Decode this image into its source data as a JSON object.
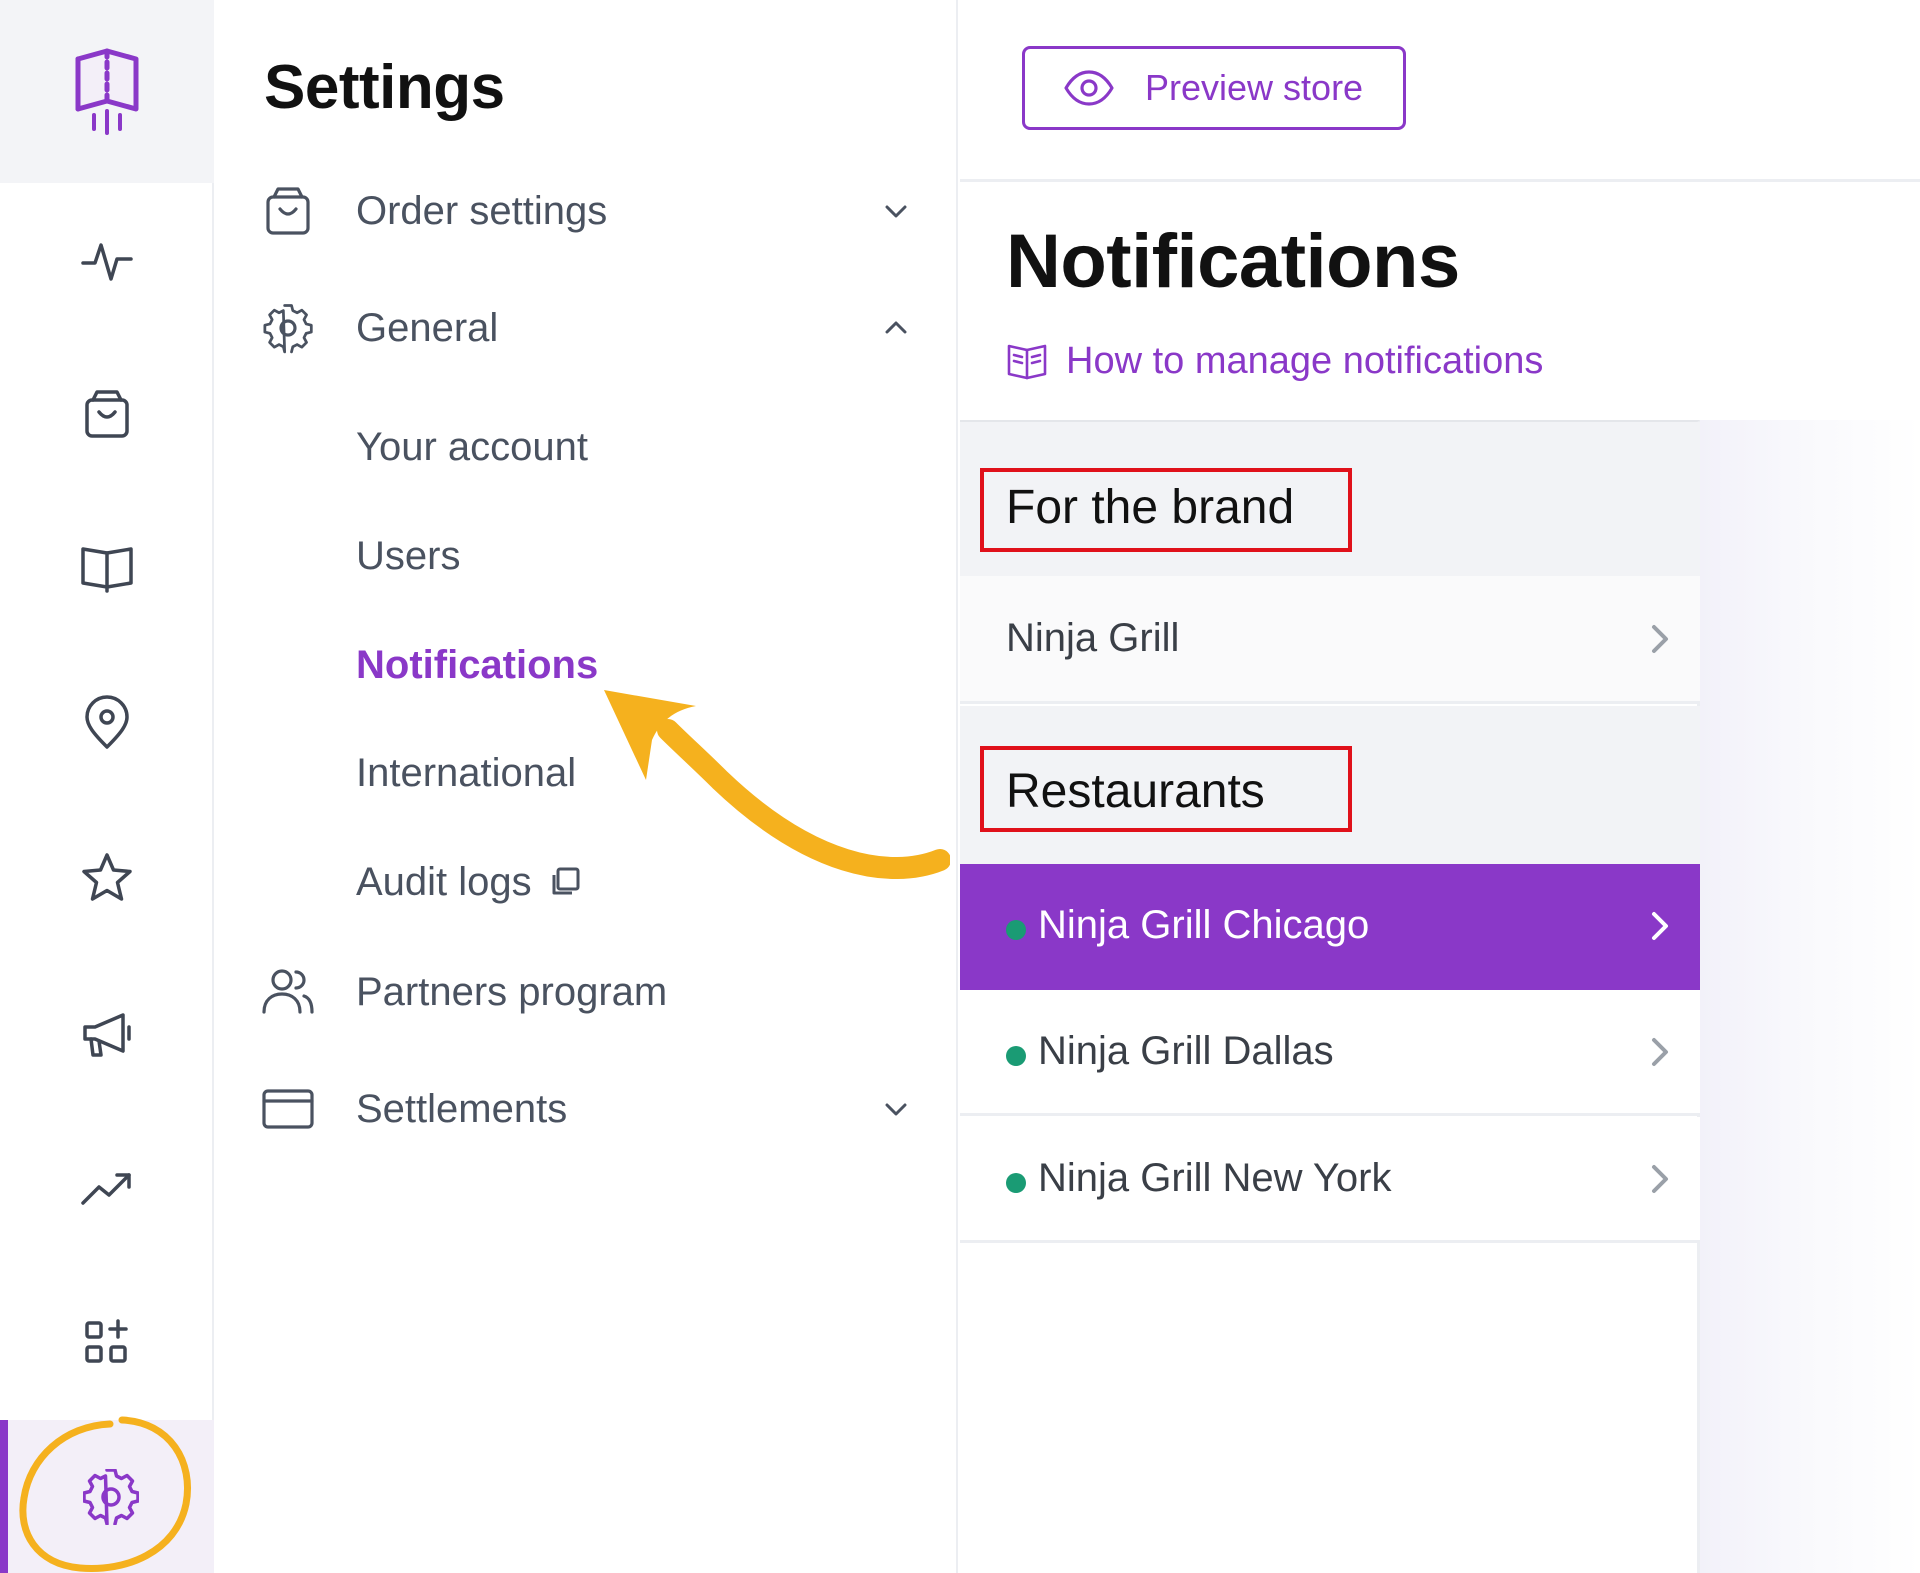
{
  "rail": {
    "items": [
      {
        "name": "activity-icon"
      },
      {
        "name": "shopping-bag-icon"
      },
      {
        "name": "book-icon"
      },
      {
        "name": "location-pin-icon"
      },
      {
        "name": "star-icon"
      },
      {
        "name": "megaphone-icon"
      },
      {
        "name": "trending-up-icon"
      },
      {
        "name": "apps-add-icon"
      },
      {
        "name": "gear-icon",
        "active": true
      }
    ]
  },
  "settings": {
    "title": "Settings",
    "menu": {
      "order_settings": "Order settings",
      "general": "General",
      "general_children": {
        "your_account": "Your account",
        "users": "Users",
        "notifications": "Notifications",
        "international": "International",
        "audit_logs": "Audit logs"
      },
      "partners_program": "Partners program",
      "settlements": "Settlements"
    }
  },
  "header": {
    "preview_store": "Preview store"
  },
  "page": {
    "title": "Notifications",
    "help_link": "How to manage notifications"
  },
  "groups": {
    "brand": {
      "heading": "For the brand",
      "items": [
        {
          "label": "Ninja Grill"
        }
      ]
    },
    "restaurants": {
      "heading": "Restaurants",
      "items": [
        {
          "label": "Ninja Grill Chicago",
          "status": "active",
          "selected": true
        },
        {
          "label": "Ninja Grill Dallas",
          "status": "active"
        },
        {
          "label": "Ninja Grill New York",
          "status": "active"
        }
      ]
    }
  },
  "colors": {
    "accent": "#8a38c8",
    "status_dot": "#1a9b74",
    "highlight_box": "#e0101a",
    "annotation": "#f5b11e"
  }
}
